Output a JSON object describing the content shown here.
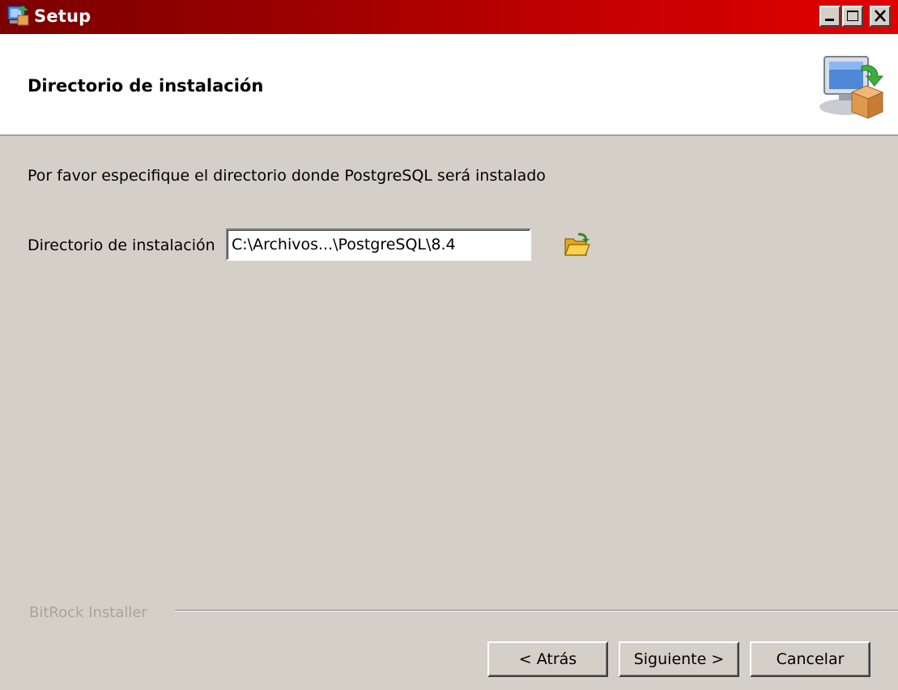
{
  "window": {
    "title": "Setup",
    "icon": "setup-app-icon",
    "controls": {
      "minimize": "minimize-icon",
      "maximize": "maximize-icon",
      "close": "close-icon"
    }
  },
  "header": {
    "title": "Directorio de instalación",
    "icon": "computer-package-icon"
  },
  "content": {
    "instruction": "Por favor especifique el directorio donde PostgreSQL será instalado",
    "directory_label": "Directorio de instalación",
    "directory_value": "C:\\Archivos...\\PostgreSQL\\8.4",
    "browse_icon": "folder-open-icon"
  },
  "footer": {
    "brand": "BitRock Installer",
    "back_label": "< Atrás",
    "next_label": "Siguiente >",
    "cancel_label": "Cancelar"
  },
  "colors": {
    "titlebar_start": "#7a0000",
    "titlebar_end": "#e00000",
    "dialog_background": "#d4d0c8",
    "header_background": "#ffffff"
  }
}
